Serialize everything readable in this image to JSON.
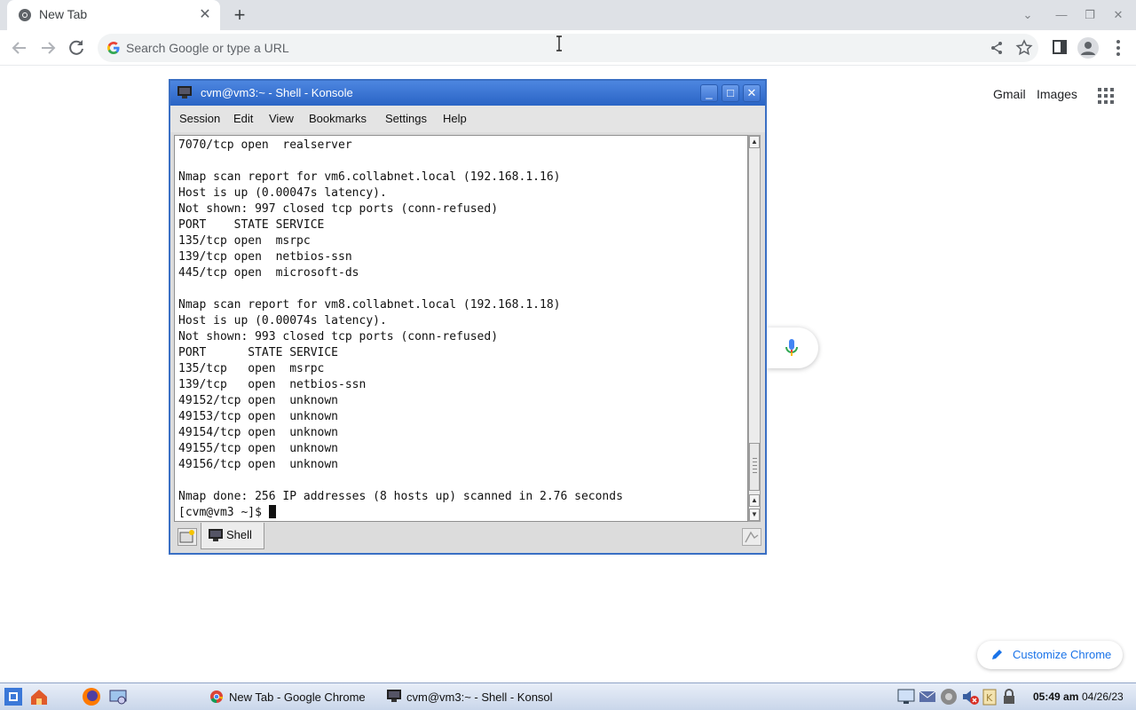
{
  "browser": {
    "tab_title": "New Tab",
    "omnibox_placeholder": "Search Google or type a URL",
    "ntp_links": {
      "gmail": "Gmail",
      "images": "Images"
    },
    "customize_label": "Customize Chrome",
    "colors": {
      "accent": "#1a73e8",
      "tabstrip": "#dee1e6"
    }
  },
  "konsole": {
    "title": "cvm@vm3:~ - Shell - Konsole",
    "menu": [
      "Session",
      "Edit",
      "View",
      "Bookmarks",
      "Settings",
      "Help"
    ],
    "terminal_lines": [
      "7070/tcp open  realserver",
      "",
      "Nmap scan report for vm6.collabnet.local (192.168.1.16)",
      "Host is up (0.00047s latency).",
      "Not shown: 997 closed tcp ports (conn-refused)",
      "PORT    STATE SERVICE",
      "135/tcp open  msrpc",
      "139/tcp open  netbios-ssn",
      "445/tcp open  microsoft-ds",
      "",
      "Nmap scan report for vm8.collabnet.local (192.168.1.18)",
      "Host is up (0.00074s latency).",
      "Not shown: 993 closed tcp ports (conn-refused)",
      "PORT      STATE SERVICE",
      "135/tcp   open  msrpc",
      "139/tcp   open  netbios-ssn",
      "49152/tcp open  unknown",
      "49153/tcp open  unknown",
      "49154/tcp open  unknown",
      "49155/tcp open  unknown",
      "49156/tcp open  unknown",
      "",
      "Nmap done: 256 IP addresses (8 hosts up) scanned in 2.76 seconds"
    ],
    "prompt": "[cvm@vm3 ~]$ ",
    "session_tab": "Shell"
  },
  "taskbar": {
    "tasks": [
      {
        "label": "New Tab - Google Chrome",
        "icon": "chrome-icon"
      },
      {
        "label": "cvm@vm3:~ - Shell - Konsol",
        "icon": "terminal-icon"
      }
    ],
    "time": "05:49 am",
    "date": "04/26/23"
  }
}
